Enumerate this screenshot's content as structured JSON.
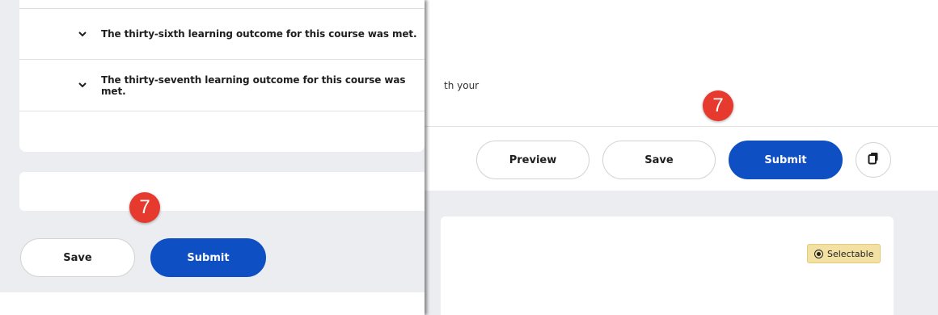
{
  "background_page": {
    "intro_text": "th your",
    "buttons": {
      "preview_label": "Preview",
      "save_label": "Save",
      "submit_label": "Submit",
      "copy_icon": "copy-icon"
    },
    "badge": {
      "label": "Selectable",
      "icon": "radio-selected-icon"
    }
  },
  "step_markers": {
    "right": "7",
    "left": "7"
  },
  "overlay": {
    "outcomes": [
      {
        "label": "The thirty-sixth learning outcome for this course was met.",
        "icon": "chevron-down-icon"
      },
      {
        "label": "The thirty-seventh learning outcome for this course was met.",
        "icon": "chevron-down-icon"
      }
    ],
    "buttons": {
      "save_label": "Save",
      "submit_label": "Submit"
    }
  },
  "colors": {
    "primary": "#0f4fc4",
    "marker": "#e63a2e",
    "badge": "#f3e1a3",
    "panel_gray": "#ebedf1"
  }
}
